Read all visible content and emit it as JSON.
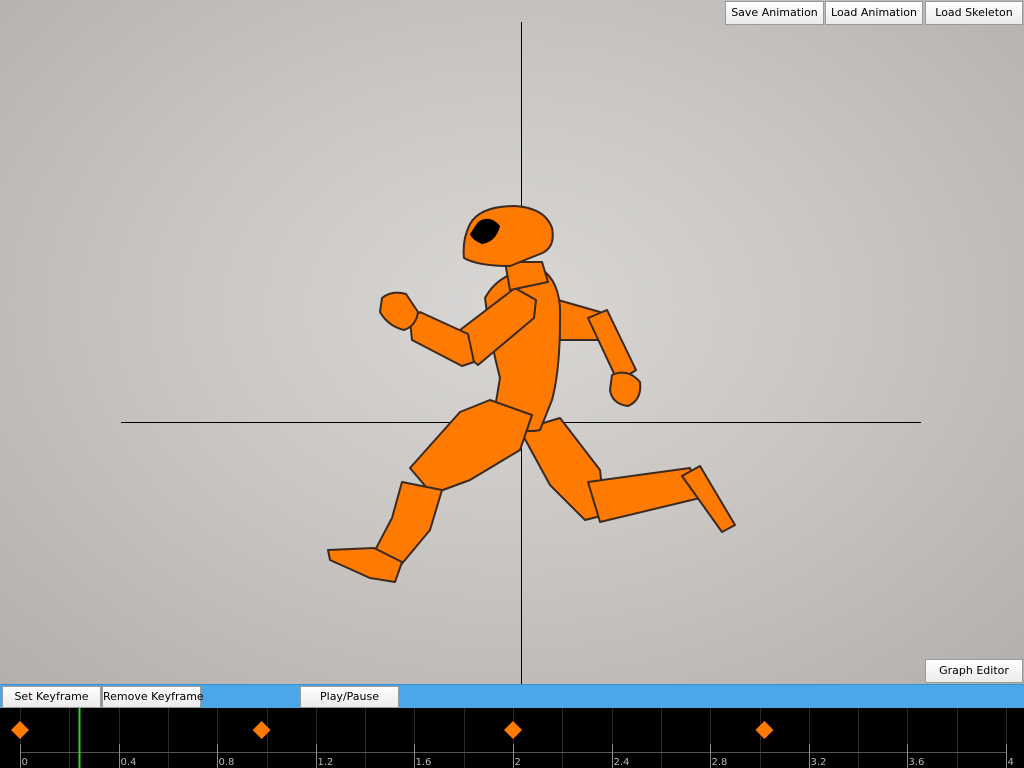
{
  "toolbar_top": {
    "save_animation": "Save Animation",
    "load_animation": "Load Animation",
    "load_skeleton": "Load Skeleton"
  },
  "graph_editor": "Graph Editor",
  "toolbar_bottom": {
    "set_keyframe": "Set Keyframe",
    "remove_keyframe": "Remove Keyframe",
    "play_pause": "Play/Pause"
  },
  "timeline": {
    "start": 0,
    "end": 4,
    "major_ticks": [
      0,
      0.4,
      0.8,
      1.2,
      1.6,
      2,
      2.4,
      2.8,
      3.2,
      3.6,
      4
    ],
    "tick_labels": [
      "0",
      "0.4",
      "0.8",
      "1.2",
      "1.6",
      "2",
      "2.4",
      "2.8",
      "3.2",
      "3.6",
      "4"
    ],
    "playhead_time": 0.24,
    "keyframes": [
      0,
      0.98,
      2.0,
      3.02
    ]
  },
  "colors": {
    "character": "#ff7a00",
    "character_outline": "#3a2a20",
    "keyframe": "#ff7a00",
    "playhead": "#22dd22",
    "toolbar": "#4aa8e8",
    "timeline_bg": "#000000"
  },
  "icons": {
    "keyframe": "keyframe-diamond-icon"
  }
}
